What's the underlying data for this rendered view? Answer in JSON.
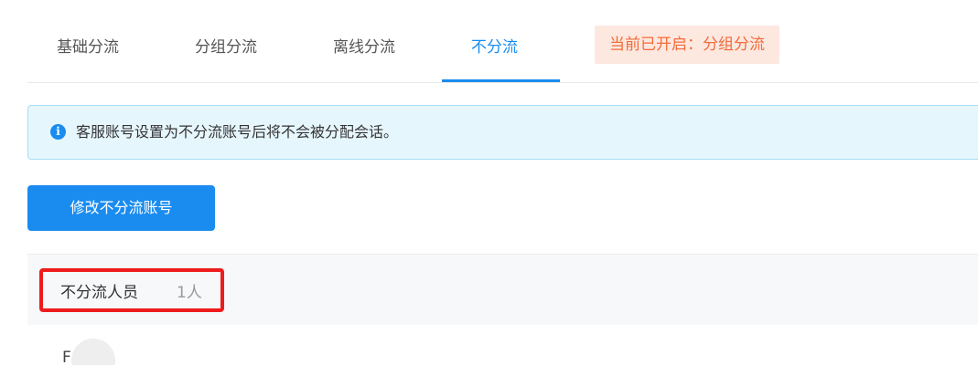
{
  "tabs": [
    {
      "label": "基础分流",
      "active": false
    },
    {
      "label": "分组分流",
      "active": false
    },
    {
      "label": "离线分流",
      "active": false
    },
    {
      "label": "不分流",
      "active": true
    }
  ],
  "status_badge": "当前已开启：分组分流",
  "alert": {
    "icon": "info-icon",
    "text": "客服账号设置为不分流账号后将不会被分配会话。"
  },
  "actions": {
    "edit_label": "修改不分流账号"
  },
  "section": {
    "title": "不分流人员",
    "count": "1人"
  },
  "members": [
    {
      "avatar_letter": "F"
    }
  ],
  "colors": {
    "accent": "#1a8cf0",
    "badge_bg": "#fde8e0",
    "badge_text": "#f26b3a",
    "alert_bg": "#e6f6fd",
    "highlight": "#ee1c1c"
  }
}
